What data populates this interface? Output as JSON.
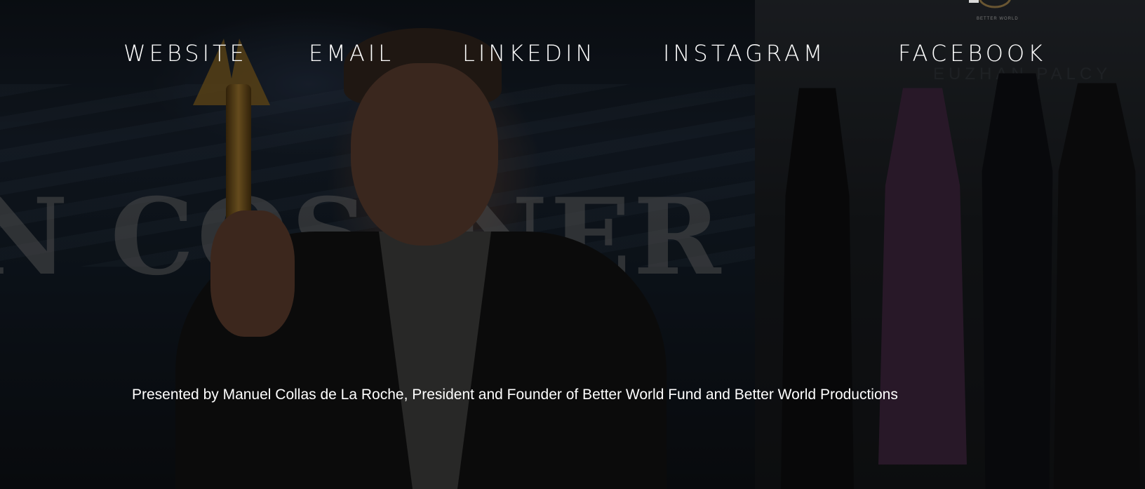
{
  "nav": {
    "links": [
      {
        "label": "WEBSITE"
      },
      {
        "label": "EMAIL"
      },
      {
        "label": "LINKEDIN"
      },
      {
        "label": "INSTAGRAM"
      },
      {
        "label": "FACEBOOK"
      }
    ]
  },
  "hero": {
    "backdrop_text": "N COSTNER",
    "banner_text": "EUZHAN PALCY",
    "caption": "Presented by Manuel Collas de La Roche, President and Founder of Better World Fund and Better World Productions"
  },
  "logo": {
    "text": "BETTER WORLD"
  },
  "colors": {
    "overlay": "#000000",
    "text": "#ffffff",
    "trophy_gold": "#b88a36"
  }
}
